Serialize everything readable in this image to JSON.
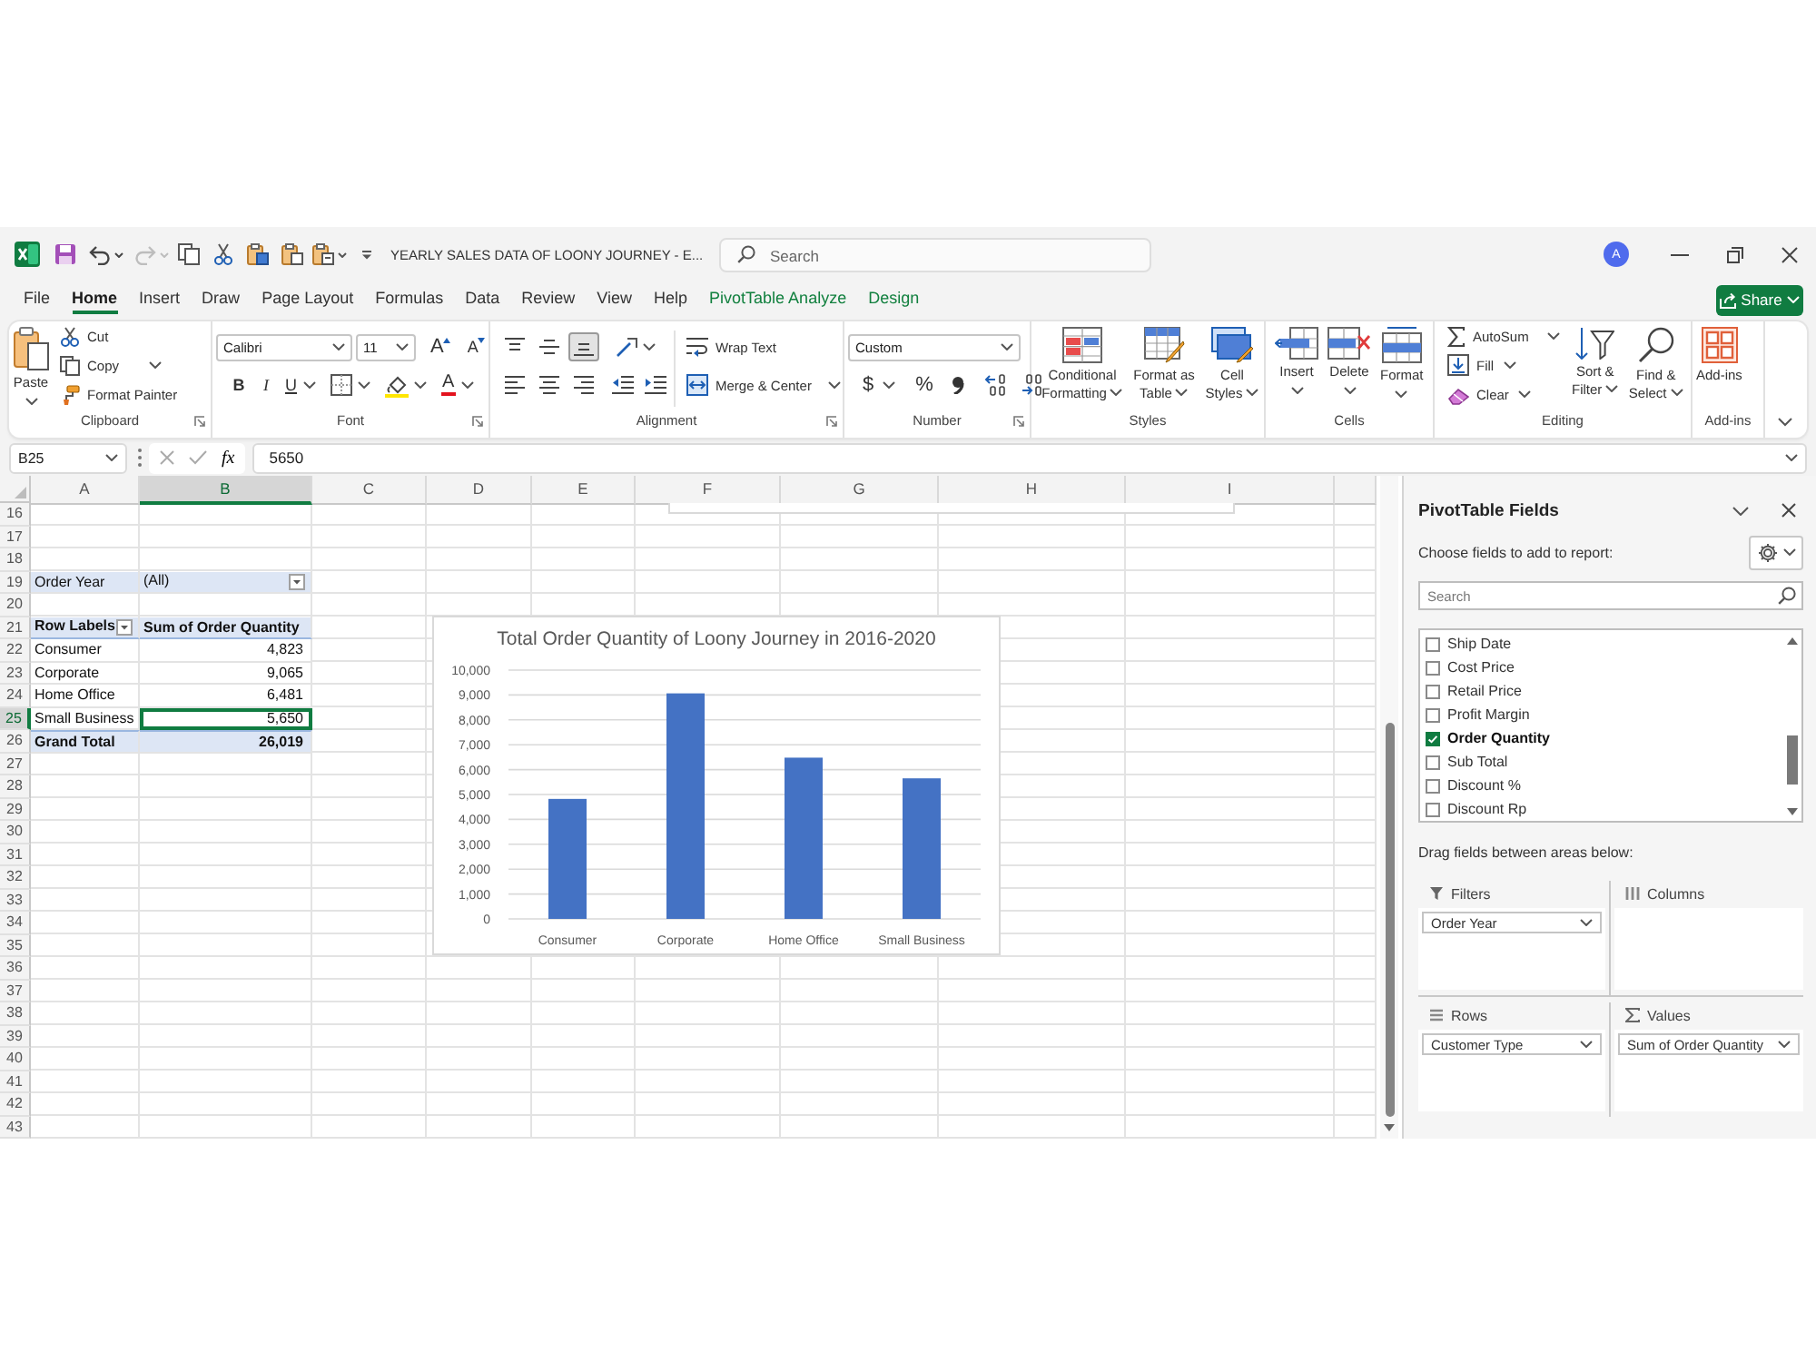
{
  "title_bar": {
    "undo": {
      "disabled": false
    },
    "redo": {
      "disabled": true
    },
    "title": "YEARLY SALES DATA OF LOONY JOURNEY - E...",
    "search": {
      "placeholder": "Search"
    },
    "account_initial": "A"
  },
  "menu": {
    "tabs": [
      {
        "label": "File",
        "kind": "standard",
        "selected": false
      },
      {
        "label": "Home",
        "kind": "standard",
        "selected": true
      },
      {
        "label": "Insert",
        "kind": "standard",
        "selected": false
      },
      {
        "label": "Draw",
        "kind": "standard",
        "selected": false
      },
      {
        "label": "Page Layout",
        "kind": "standard",
        "selected": false
      },
      {
        "label": "Formulas",
        "kind": "standard",
        "selected": false
      },
      {
        "label": "Data",
        "kind": "standard",
        "selected": false
      },
      {
        "label": "Review",
        "kind": "standard",
        "selected": false
      },
      {
        "label": "View",
        "kind": "standard",
        "selected": false
      },
      {
        "label": "Help",
        "kind": "standard",
        "selected": false
      },
      {
        "label": "PivotTable Analyze",
        "kind": "contextual",
        "selected": false
      },
      {
        "label": "Design",
        "kind": "contextual",
        "selected": false
      }
    ],
    "share_button": "Share"
  },
  "ribbon": {
    "groups": [
      {
        "kind": "clipboard",
        "label": "Clipboard",
        "launcher": true,
        "paste": "Paste",
        "cut": "Cut",
        "copy": "Copy",
        "format_painter": "Format Painter"
      },
      {
        "kind": "font",
        "label": "Font",
        "launcher": true,
        "font_name": "Calibri",
        "font_size": "11",
        "grow": "A",
        "shrink": "A",
        "bold": "B",
        "italic": "I",
        "underline": "U",
        "font_color": "A"
      },
      {
        "kind": "alignment",
        "label": "Alignment",
        "launcher": true,
        "vertical": [
          {
            "selected": false
          },
          {
            "selected": false
          },
          {
            "selected": true
          }
        ],
        "horizontal": [
          {
            "selected": false
          },
          {
            "selected": false
          },
          {
            "selected": false
          }
        ],
        "wrap_text": "Wrap Text",
        "merge": "Merge & Center"
      },
      {
        "kind": "number",
        "label": "Number",
        "launcher": true,
        "format": "Custom",
        "currency": "$",
        "percent": "%"
      },
      {
        "kind": "styles",
        "label": "Styles",
        "launcher": false,
        "buttons": [
          "Conditional Formatting",
          "Format as Table",
          "Cell Styles"
        ]
      },
      {
        "kind": "cells",
        "label": "Cells",
        "launcher": false,
        "buttons": [
          "Insert",
          "Delete",
          "Format"
        ]
      },
      {
        "kind": "editing",
        "label": "Editing",
        "launcher": false,
        "autosum": "AutoSum",
        "fill": "Fill",
        "clear": "Clear",
        "sort": "Sort & Filter",
        "find": "Find & Select"
      },
      {
        "kind": "addins",
        "label": "Add-ins",
        "launcher": false,
        "button": "Add-ins"
      }
    ]
  },
  "formula_bar": {
    "name_box": "B25",
    "function_label": "fx",
    "value": "5650"
  },
  "sheet": {
    "columns": [
      {
        "label": "A",
        "selected": false
      },
      {
        "label": "B",
        "selected": true
      },
      {
        "label": "C",
        "selected": false
      },
      {
        "label": "D",
        "selected": false
      },
      {
        "label": "E",
        "selected": false
      },
      {
        "label": "F",
        "selected": false
      },
      {
        "label": "G",
        "selected": false
      },
      {
        "label": "H",
        "selected": false
      },
      {
        "label": "I",
        "selected": false
      }
    ],
    "rows": [
      {
        "label": "16",
        "selected": false
      },
      {
        "label": "17",
        "selected": false
      },
      {
        "label": "18",
        "selected": false
      },
      {
        "label": "19",
        "selected": false
      },
      {
        "label": "20",
        "selected": false
      },
      {
        "label": "21",
        "selected": false
      },
      {
        "label": "22",
        "selected": false
      },
      {
        "label": "23",
        "selected": false
      },
      {
        "label": "24",
        "selected": false
      },
      {
        "label": "25",
        "selected": true
      },
      {
        "label": "26",
        "selected": false
      },
      {
        "label": "27",
        "selected": false
      },
      {
        "label": "28",
        "selected": false
      },
      {
        "label": "29",
        "selected": false
      },
      {
        "label": "30",
        "selected": false
      },
      {
        "label": "31",
        "selected": false
      },
      {
        "label": "32",
        "selected": false
      },
      {
        "label": "33",
        "selected": false
      },
      {
        "label": "34",
        "selected": false
      },
      {
        "label": "35",
        "selected": false
      },
      {
        "label": "36",
        "selected": false
      },
      {
        "label": "37",
        "selected": false
      },
      {
        "label": "38",
        "selected": false
      },
      {
        "label": "39",
        "selected": false
      },
      {
        "label": "40",
        "selected": false
      },
      {
        "label": "41",
        "selected": false
      },
      {
        "label": "42",
        "selected": false
      },
      {
        "label": "43",
        "selected": false
      }
    ]
  },
  "pivot_table": {
    "filter": {
      "field": "Order Year",
      "value": "(All)"
    },
    "header": {
      "rows_label": "Row Labels",
      "values_label": "Sum of Order Quantity"
    },
    "rows": [
      {
        "label": "Consumer",
        "value": "4,823",
        "selected": false
      },
      {
        "label": "Corporate",
        "value": "9,065",
        "selected": false
      },
      {
        "label": "Home Office",
        "value": "6,481",
        "selected": false
      },
      {
        "label": "Small Business",
        "value": "5,650",
        "selected": true
      }
    ],
    "total": {
      "label": "Grand Total",
      "value": "26,019"
    }
  },
  "chart": {
    "chart_data": {
      "type": "bar",
      "title": "Total Order Quantity of Loony Journey in 2016-2020",
      "categories": [
        "Consumer",
        "Corporate",
        "Home Office",
        "Small Business"
      ],
      "values": [
        4823,
        9065,
        6481,
        5650
      ],
      "ylim": [
        0,
        10000
      ],
      "yticks": [
        0,
        {
          "value": 1000,
          "label": "1,000"
        },
        {
          "value": 2000,
          "label": "2,000"
        },
        {
          "value": 3000,
          "label": "3,000"
        },
        {
          "value": 4000,
          "label": "4,000"
        },
        {
          "value": 5000,
          "label": "5,000"
        },
        {
          "value": 6000,
          "label": "6,000"
        },
        {
          "value": 7000,
          "label": "7,000"
        },
        {
          "value": 8000,
          "label": "8,000"
        },
        {
          "value": 9000,
          "label": "9,000"
        },
        {
          "value": 10000,
          "label": "10,000"
        }
      ],
      "grid": true
    }
  },
  "pivot_fields": {
    "title": "PivotTable Fields",
    "subtitle": "Choose fields to add to report:",
    "search": {
      "placeholder": "Search"
    },
    "fields": [
      {
        "label": "Ship Date",
        "checked": false
      },
      {
        "label": "Cost Price",
        "checked": false
      },
      {
        "label": "Retail Price",
        "checked": false
      },
      {
        "label": "Profit Margin",
        "checked": false
      },
      {
        "label": "Order Quantity",
        "checked": true
      },
      {
        "label": "Sub Total",
        "checked": false
      },
      {
        "label": "Discount %",
        "checked": false
      },
      {
        "label": "Discount Rp",
        "checked": false
      }
    ],
    "areas_hint": "Drag fields between areas below:",
    "areas": [
      {
        "kind": "filters",
        "label": "Filters",
        "items": [
          "Order Year"
        ]
      },
      {
        "kind": "columns",
        "label": "Columns"
      },
      {
        "kind": "rows",
        "label": "Rows",
        "items": [
          "Customer Type"
        ]
      },
      {
        "kind": "values",
        "label": "Values",
        "items": [
          "Sum of Order Quantity"
        ]
      }
    ]
  }
}
